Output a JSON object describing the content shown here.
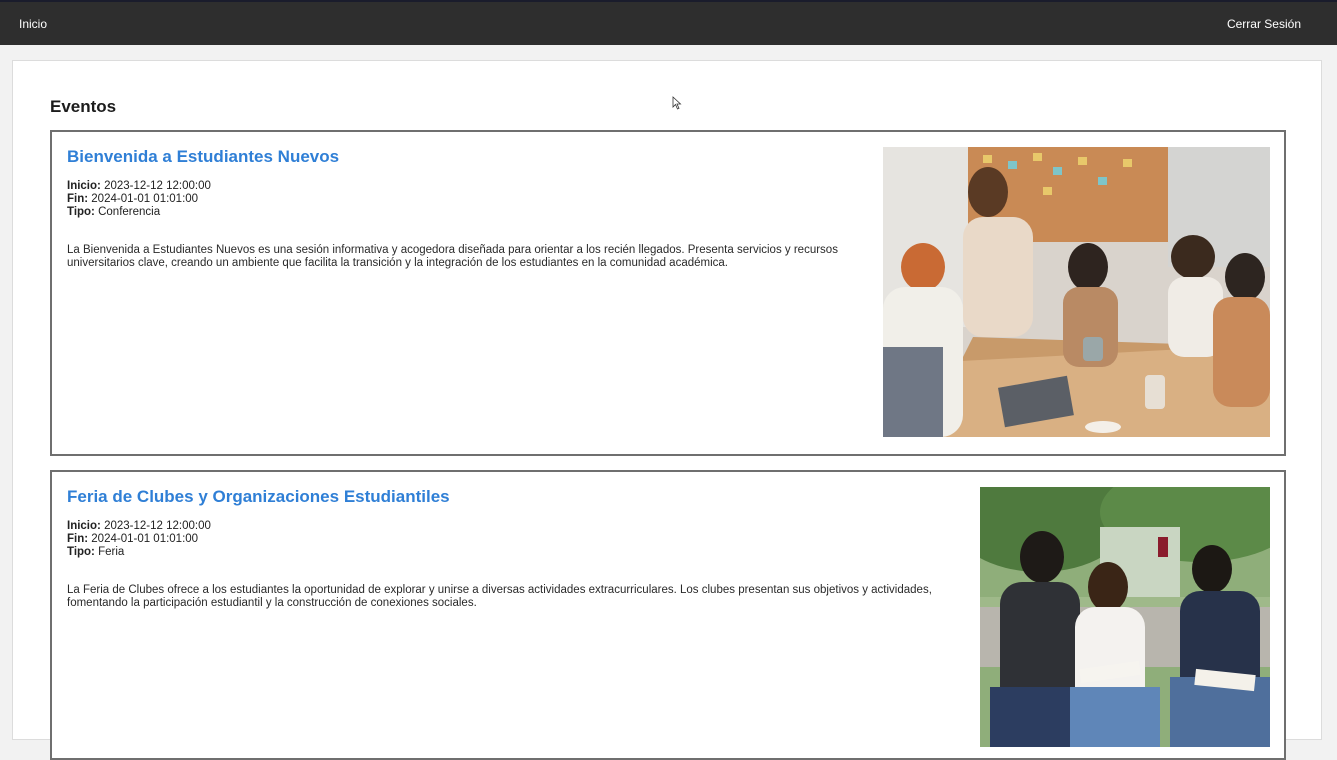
{
  "nav": {
    "home_label": "Inicio",
    "logout_label": "Cerrar Sesión"
  },
  "page": {
    "title": "Eventos"
  },
  "labels": {
    "start": "Inicio:",
    "end": "Fin:",
    "type": "Tipo:"
  },
  "events": [
    {
      "title": "Bienvenida a Estudiantes Nuevos",
      "start": "2023-12-12 12:00:00",
      "end": "2024-01-01 01:01:00",
      "type": "Conferencia",
      "description": "La Bienvenida a Estudiantes Nuevos es una sesión informativa y acogedora diseñada para orientar a los recién llegados. Presenta servicios y recursos universitarios clave, creando un ambiente que facilita la transición y la integración de los estudiantes en la comunidad académica."
    },
    {
      "title": "Feria de Clubes y Organizaciones Estudiantiles",
      "start": "2023-12-12 12:00:00",
      "end": "2024-01-01 01:01:00",
      "type": "Feria",
      "description": "La Feria de Clubes ofrece a los estudiantes la oportunidad de explorar y unirse a diversas actividades extracurriculares. Los clubes presentan sus objetivos y actividades, fomentando la participación estudiantil y la construcción de conexiones sociales."
    }
  ],
  "colors": {
    "topbar": "#2e2e2e",
    "event_title": "#2f7fd6",
    "card_border": "#6f6f6f"
  }
}
